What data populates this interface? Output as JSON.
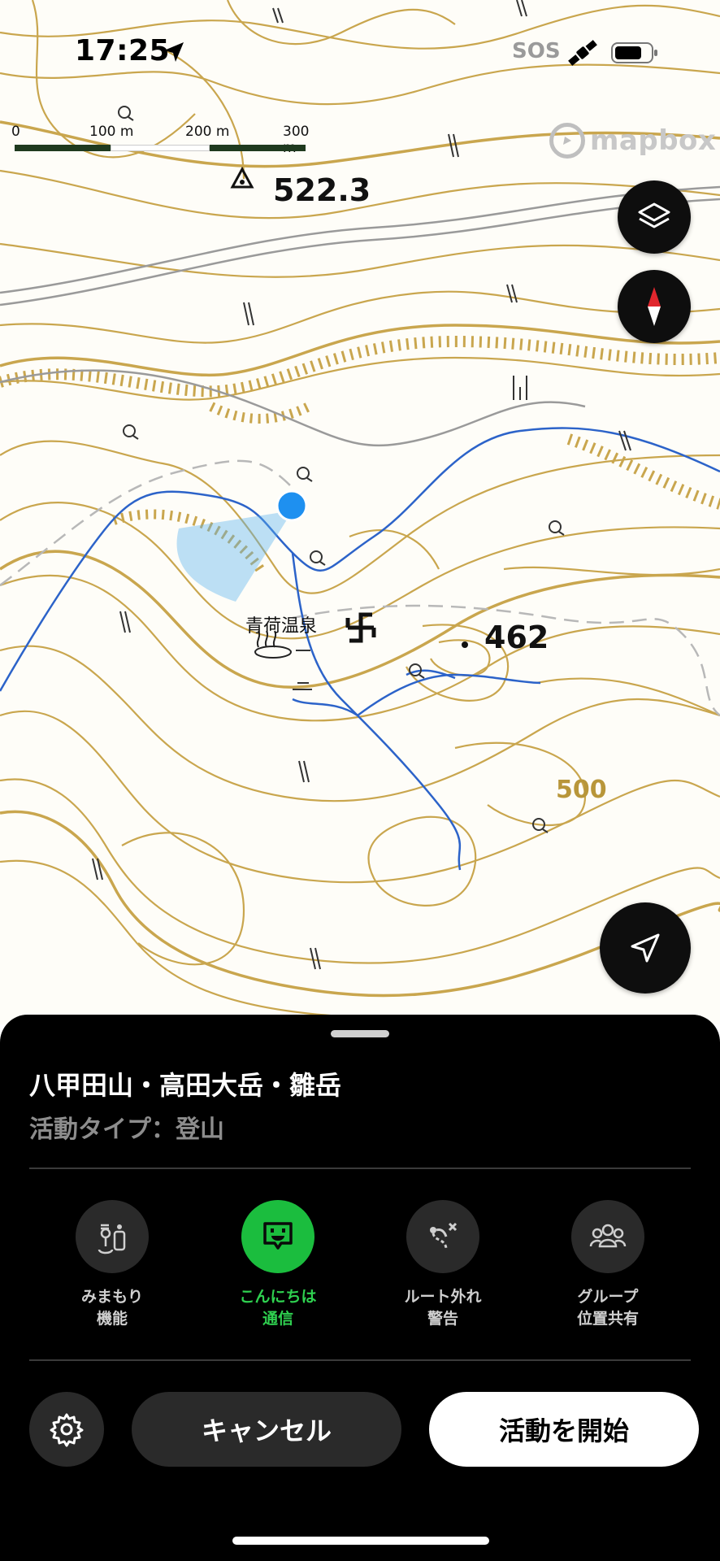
{
  "status_bar": {
    "time": "17:25",
    "sos": "SOS"
  },
  "map": {
    "scale_labels": [
      "0",
      "100 m",
      "200 m",
      "300 m"
    ],
    "attribution": "mapbox",
    "peak_elevation": "522.3",
    "spot_elevation": "462",
    "onsen_name": "青荷温泉",
    "contour_value": "500",
    "colors": {
      "contour": "#b8963a",
      "stream": "#2c63c9",
      "road": "#8f8f8f",
      "user_location": "#1e90f0"
    }
  },
  "sheet": {
    "title": "八甲田山・高田大岳・雛岳",
    "activity_type": "活動タイプ：登山",
    "features": [
      {
        "line1": "みまもり",
        "line2": "機能",
        "icon": "watch-over-icon",
        "active": false
      },
      {
        "line1": "こんにちは",
        "line2": "通信",
        "icon": "hello-chat-icon",
        "active": true
      },
      {
        "line1": "ルート外れ",
        "line2": "警告",
        "icon": "off-route-icon",
        "active": false
      },
      {
        "line1": "グループ",
        "line2": "位置共有",
        "icon": "group-share-icon",
        "active": false
      }
    ],
    "cancel_label": "キャンセル",
    "start_label": "活動を開始",
    "colors": {
      "active": "#1bbd3e",
      "background": "#000000"
    }
  }
}
